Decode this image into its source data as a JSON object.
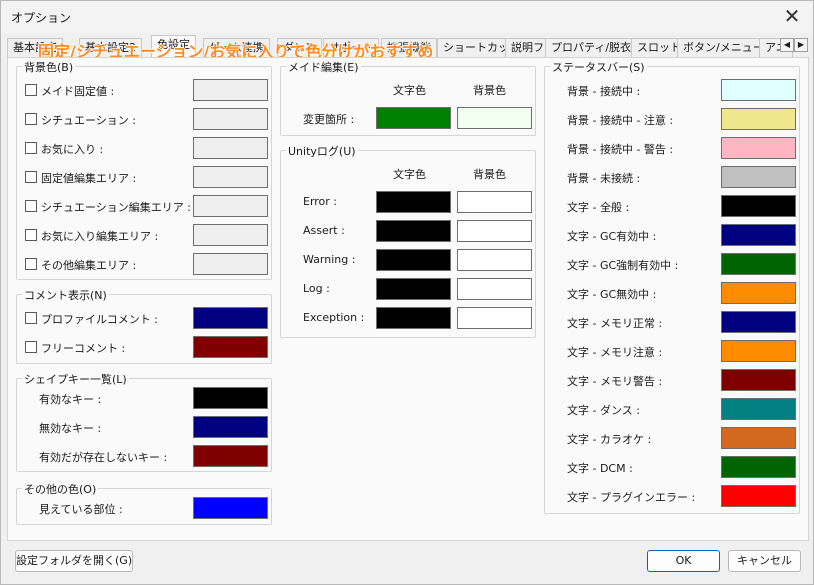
{
  "window": {
    "title": "オプション"
  },
  "overlay_caption": "固定/シチュエーション/お気に入りで色分けがおすすめ",
  "tabs": [
    {
      "label": "基本設定"
    },
    {
      "label": "基本設定2"
    },
    {
      "label": "色設定"
    },
    {
      "label": "ゲーム連携"
    },
    {
      "label": "ダンス"
    },
    {
      "label": "サポート"
    },
    {
      "label": "拡張機能"
    },
    {
      "label": "ショートカット"
    },
    {
      "label": "説明ファイル"
    },
    {
      "label": "プロパティ/脱衣"
    },
    {
      "label": "スロット"
    },
    {
      "label": "ボタン/メニュー"
    },
    {
      "label": "アニ"
    }
  ],
  "background_group": {
    "legend": "背景色(B)",
    "items": [
      {
        "label": "メイド固定値 :",
        "color": "#efefef",
        "checked": false
      },
      {
        "label": "シチュエーション :",
        "color": "#efefef",
        "checked": false
      },
      {
        "label": "お気に入り :",
        "color": "#efefef",
        "checked": false
      },
      {
        "label": "固定値編集エリア :",
        "color": "#efefef",
        "checked": false
      },
      {
        "label": "シチュエーション編集エリア :",
        "color": "#efefef",
        "checked": false
      },
      {
        "label": "お気に入り編集エリア :",
        "color": "#efefef",
        "checked": false
      },
      {
        "label": "その他編集エリア :",
        "color": "#efefef",
        "checked": false
      }
    ]
  },
  "comment_group": {
    "legend": "コメント表示(N)",
    "items": [
      {
        "label": "プロファイルコメント :",
        "color": "#000080",
        "checked": false
      },
      {
        "label": "フリーコメント :",
        "color": "#800000",
        "checked": false
      }
    ]
  },
  "shapekey_group": {
    "legend": "シェイプキー一覧(L)",
    "items": [
      {
        "label": "有効なキー :",
        "color": "#000000"
      },
      {
        "label": "無効なキー :",
        "color": "#000080"
      },
      {
        "label": "有効だが存在しないキー :",
        "color": "#800000"
      }
    ]
  },
  "other_group": {
    "legend": "その他の色(O)",
    "items": [
      {
        "label": "見えている部位 :",
        "color": "#0000ff"
      }
    ]
  },
  "maid_edit_group": {
    "legend": "メイド編集(E)",
    "text_header": "文字色",
    "bg_header": "背景色",
    "rows": [
      {
        "label": "変更箇所 :",
        "text_color": "#008000",
        "bg_color": "#f0fff0"
      }
    ]
  },
  "unity_log_group": {
    "legend": "Unityログ(U)",
    "text_header": "文字色",
    "bg_header": "背景色",
    "rows": [
      {
        "label": "Error :",
        "text_color": "#000000",
        "bg_color": "#ffffff"
      },
      {
        "label": "Assert :",
        "text_color": "#000000",
        "bg_color": "#ffffff"
      },
      {
        "label": "Warning :",
        "text_color": "#000000",
        "bg_color": "#ffffff"
      },
      {
        "label": "Log :",
        "text_color": "#000000",
        "bg_color": "#ffffff"
      },
      {
        "label": "Exception :",
        "text_color": "#000000",
        "bg_color": "#ffffff"
      }
    ]
  },
  "status_group": {
    "legend": "ステータスバー(S)",
    "items": [
      {
        "label": "背景 - 接続中 :",
        "color": "#e0ffff"
      },
      {
        "label": "背景 - 接続中 - 注意 :",
        "color": "#f0e68c"
      },
      {
        "label": "背景 - 接続中 - 警告 :",
        "color": "#ffb6c1"
      },
      {
        "label": "背景 - 未接続 :",
        "color": "#c0c0c0"
      },
      {
        "label": "文字 - 全般 :",
        "color": "#000000"
      },
      {
        "label": "文字 - GC有効中 :",
        "color": "#000080"
      },
      {
        "label": "文字 - GC強制有効中 :",
        "color": "#006400"
      },
      {
        "label": "文字 - GC無効中 :",
        "color": "#ff8c00"
      },
      {
        "label": "文字 - メモリ正常 :",
        "color": "#000080"
      },
      {
        "label": "文字 - メモリ注意 :",
        "color": "#ff8c00"
      },
      {
        "label": "文字 - メモリ警告 :",
        "color": "#800000"
      },
      {
        "label": "文字 - ダンス :",
        "color": "#008080"
      },
      {
        "label": "文字 - カラオケ :",
        "color": "#d2691e"
      },
      {
        "label": "文字 - DCM :",
        "color": "#006400"
      },
      {
        "label": "文字 - プラグインエラー :",
        "color": "#ff0000"
      }
    ]
  },
  "footer": {
    "open_folder_label": "設定フォルダを開く(G)",
    "ok_label": "OK",
    "cancel_label": "キャンセル"
  },
  "colors": {
    "accent": "#0067c0",
    "overlay_text": "#ff8a1f"
  }
}
